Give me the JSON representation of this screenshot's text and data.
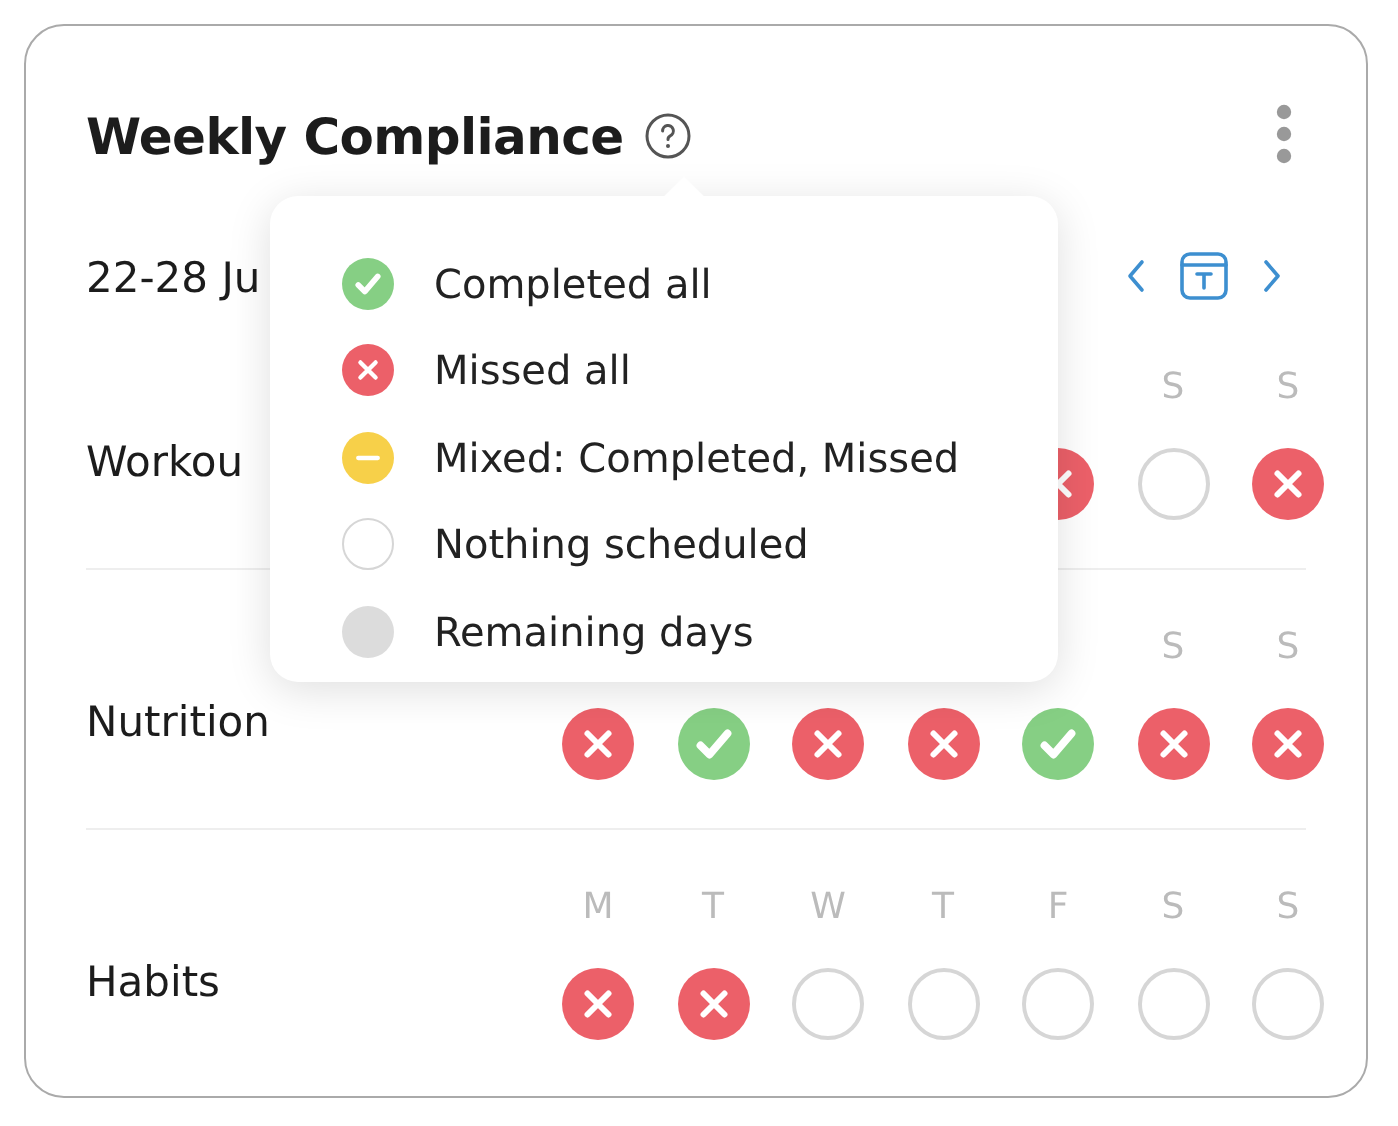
{
  "card": {
    "title": "Weekly Compliance",
    "date_range": "22-28 Ju"
  },
  "legend": [
    {
      "kind": "completed",
      "label": "Completed all"
    },
    {
      "kind": "missed",
      "label": "Missed all"
    },
    {
      "kind": "mixed",
      "label": "Mixed: Completed, Missed"
    },
    {
      "kind": "empty",
      "label": "Nothing scheduled"
    },
    {
      "kind": "remaining",
      "label": "Remaining days"
    }
  ],
  "rows": [
    {
      "name": "Workou",
      "days": [
        {
          "kind": "missed"
        },
        {
          "label": "S",
          "kind": "empty"
        },
        {
          "label": "S",
          "kind": "missed"
        }
      ]
    },
    {
      "name": "Nutrition",
      "days": [
        {
          "kind": "missed"
        },
        {
          "kind": "completed"
        },
        {
          "kind": "missed"
        },
        {
          "kind": "missed"
        },
        {
          "kind": "completed"
        },
        {
          "label": "S",
          "kind": "missed"
        },
        {
          "label": "S",
          "kind": "missed"
        }
      ]
    },
    {
      "name": "Habits",
      "days": [
        {
          "label": "M",
          "kind": "missed"
        },
        {
          "label": "T",
          "kind": "missed"
        },
        {
          "label": "W",
          "kind": "empty"
        },
        {
          "label": "T",
          "kind": "empty"
        },
        {
          "label": "F",
          "kind": "empty"
        },
        {
          "label": "S",
          "kind": "empty"
        },
        {
          "label": "S",
          "kind": "empty"
        }
      ]
    }
  ]
}
